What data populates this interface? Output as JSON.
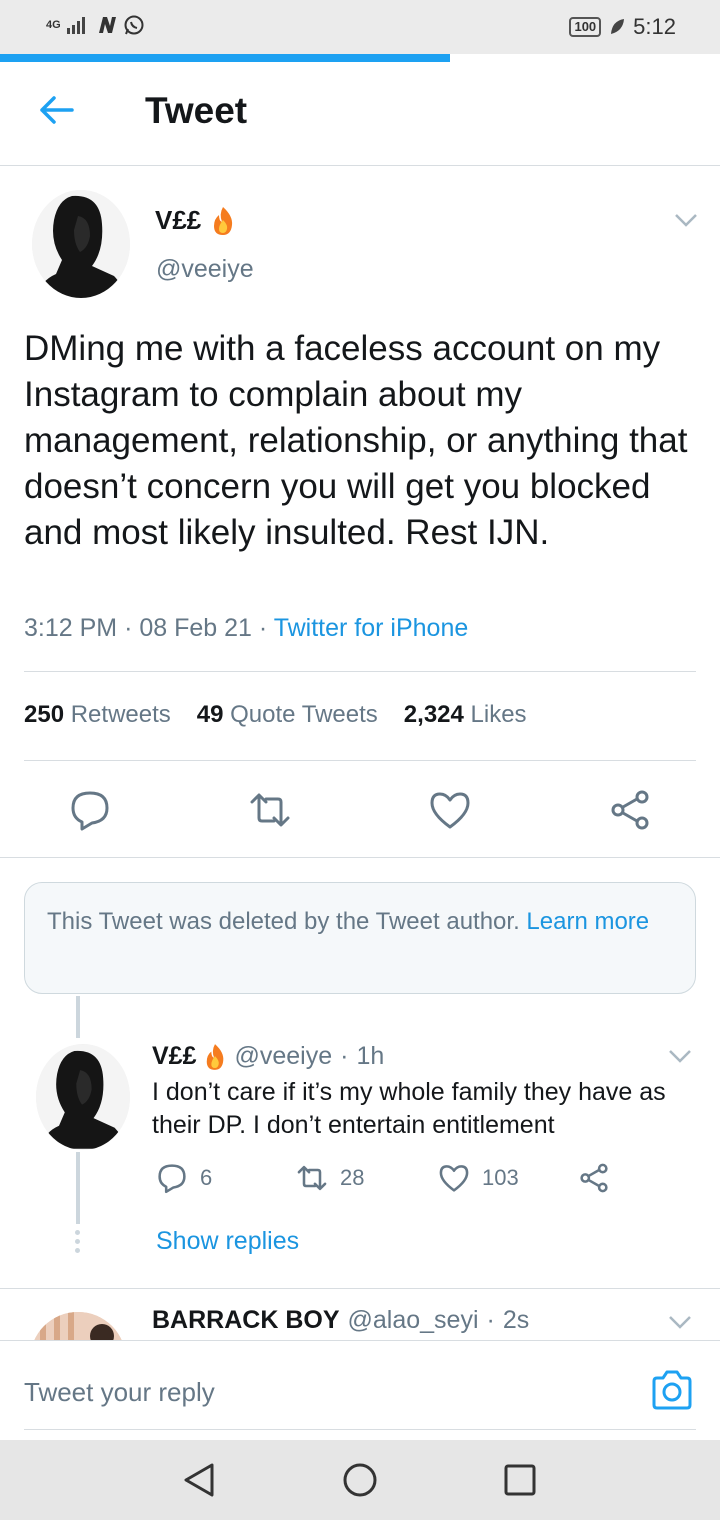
{
  "status_bar": {
    "network": "4G",
    "battery": "100",
    "time": "5:12"
  },
  "loading_progress": 0.625,
  "header": {
    "title": "Tweet"
  },
  "tweet": {
    "name": "V££",
    "handle": "@veeiye",
    "text": "DMing me with a faceless account on my Instagram to complain about my management, relationship, or anything that doesn’t concern you will get you blocked and most likely insulted. Rest IJN.",
    "time": "3:12 PM",
    "date": "08 Feb 21",
    "source": "Twitter for iPhone",
    "stats": {
      "retweets_count": "250",
      "retweets_label": "Retweets",
      "quotes_count": "49",
      "quotes_label": "Quote Tweets",
      "likes_count": "2,324",
      "likes_label": "Likes"
    }
  },
  "deleted_notice": {
    "text": "This Tweet was deleted by the Tweet author.",
    "link": "Learn more"
  },
  "reply": {
    "name": "V££",
    "handle": "@veeiye",
    "time": "1h",
    "text": "I don’t care if it’s my whole family they have as their DP. I don’t entertain entitlement",
    "replies": "6",
    "retweets": "28",
    "likes": "103",
    "show_replies": "Show replies"
  },
  "next_reply": {
    "name": "BARRACK BOY",
    "handle": "@alao_seyi",
    "time": "2s"
  },
  "composer": {
    "placeholder": "Tweet your reply"
  },
  "colors": {
    "accent": "#1da1f2",
    "link": "#1b95e0",
    "muted": "#657786"
  }
}
